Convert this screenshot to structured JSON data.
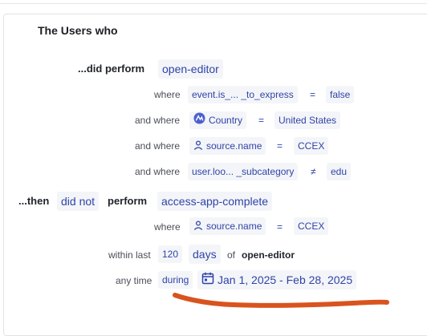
{
  "header": {
    "title": "The Users who"
  },
  "perform_block": {
    "prefix": "...did perform",
    "event": "open-editor",
    "filters": [
      {
        "label": "where",
        "property": "event.is_... _to_express",
        "operator": "=",
        "value": "false",
        "icon": ""
      },
      {
        "label": "and where",
        "property": "Country",
        "operator": "=",
        "value": "United States",
        "icon": "globe-icon"
      },
      {
        "label": "and where",
        "property": "source.name",
        "operator": "=",
        "value": "CCEX",
        "icon": "user-icon"
      },
      {
        "label": "and where",
        "property": "user.loo... _subcategory",
        "operator": "≠",
        "value": "edu",
        "icon": ""
      }
    ]
  },
  "then_block": {
    "prefix": "...then",
    "negation": "did not",
    "verb": "perform",
    "event": "access-app-complete",
    "filters": [
      {
        "label": "where",
        "property": "source.name",
        "operator": "=",
        "value": "CCEX",
        "icon": "user-icon"
      }
    ],
    "within": {
      "label": "within last",
      "count": "120",
      "unit": "days",
      "of_label": "of",
      "of_event": "open-editor"
    },
    "time": {
      "label": "any time",
      "mode": "during",
      "range": "Jan 1, 2025 - Feb 28, 2025"
    }
  },
  "colors": {
    "accent": "#2f44a8",
    "chip_bg": "#f4f5f8",
    "annotation": "#d9531e"
  }
}
